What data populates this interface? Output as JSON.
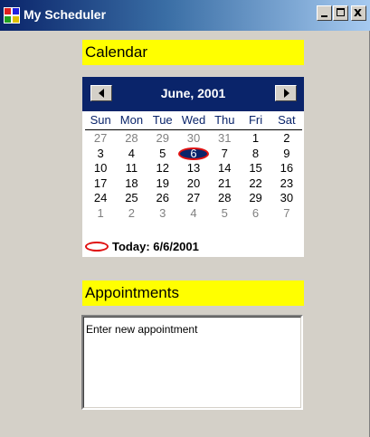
{
  "window": {
    "title": "My Scheduler",
    "close_glyph": "x"
  },
  "calendar_label": "Calendar",
  "calendar": {
    "month_title": "June, 2001",
    "days_of_week": [
      "Sun",
      "Mon",
      "Tue",
      "Wed",
      "Thu",
      "Fri",
      "Sat"
    ],
    "weeks": [
      [
        {
          "d": "27",
          "m": true
        },
        {
          "d": "28",
          "m": true
        },
        {
          "d": "29",
          "m": true
        },
        {
          "d": "30",
          "m": true
        },
        {
          "d": "31",
          "m": true
        },
        {
          "d": "1"
        },
        {
          "d": "2"
        }
      ],
      [
        {
          "d": "3"
        },
        {
          "d": "4"
        },
        {
          "d": "5"
        },
        {
          "d": "6",
          "sel": true
        },
        {
          "d": "7"
        },
        {
          "d": "8"
        },
        {
          "d": "9"
        }
      ],
      [
        {
          "d": "10"
        },
        {
          "d": "11"
        },
        {
          "d": "12"
        },
        {
          "d": "13"
        },
        {
          "d": "14"
        },
        {
          "d": "15"
        },
        {
          "d": "16"
        }
      ],
      [
        {
          "d": "17"
        },
        {
          "d": "18"
        },
        {
          "d": "19"
        },
        {
          "d": "20"
        },
        {
          "d": "21"
        },
        {
          "d": "22"
        },
        {
          "d": "23"
        }
      ],
      [
        {
          "d": "24"
        },
        {
          "d": "25"
        },
        {
          "d": "26"
        },
        {
          "d": "27"
        },
        {
          "d": "28"
        },
        {
          "d": "29"
        },
        {
          "d": "30"
        }
      ],
      [
        {
          "d": "1",
          "m": true
        },
        {
          "d": "2",
          "m": true
        },
        {
          "d": "3",
          "m": true
        },
        {
          "d": "4",
          "m": true
        },
        {
          "d": "5",
          "m": true
        },
        {
          "d": "6",
          "m": true
        },
        {
          "d": "7",
          "m": true
        }
      ]
    ],
    "today_text": "Today: 6/6/2001"
  },
  "appointments_label": "Appointments",
  "appointment_input": {
    "value": "Enter new appointment"
  },
  "colors": {
    "label_bg": "#ffff00",
    "calendar_header_bg": "#0a246a",
    "today_marker": "#e01010",
    "window_bg": "#d4d0c8"
  }
}
